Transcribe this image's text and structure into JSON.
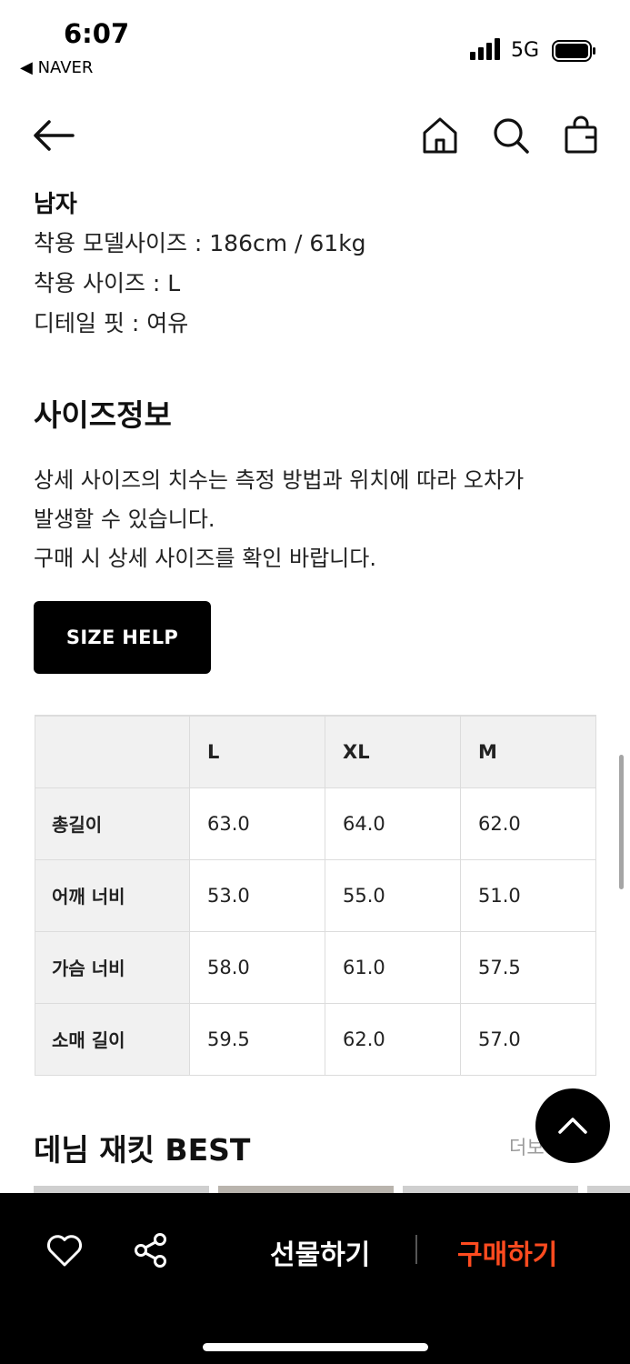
{
  "status_bar": {
    "time": "6:07",
    "back_app": "◀ NAVER",
    "network": "5G"
  },
  "header": {
    "icons": [
      "arrow-left-icon",
      "home-icon",
      "search-icon",
      "shopping-bag-icon"
    ]
  },
  "model_info": {
    "gender": "남자",
    "lines": [
      "착용 모델사이즈 : 186cm / 61kg",
      "착용 사이즈 : L",
      "디테일 핏 : 여유"
    ]
  },
  "size_info": {
    "title": "사이즈정보",
    "description": [
      "상세 사이즈의 치수는 측정 방법과 위치에 따라 오차가",
      "발생할 수 있습니다.",
      "구매 시 상세 사이즈를 확인 바랍니다."
    ],
    "help_button": "SIZE HELP"
  },
  "size_table": {
    "headers": [
      "",
      "L",
      "XL",
      "M"
    ],
    "rows": [
      {
        "label": "총길이",
        "values": [
          "63.0",
          "64.0",
          "62.0"
        ]
      },
      {
        "label": "어깨 너비",
        "values": [
          "53.0",
          "55.0",
          "51.0"
        ]
      },
      {
        "label": "가슴 너비",
        "values": [
          "58.0",
          "61.0",
          "57.5"
        ]
      },
      {
        "label": "소매 길이",
        "values": [
          "59.5",
          "62.0",
          "57.0"
        ]
      }
    ]
  },
  "best_section": {
    "title": "데님 재킷 BEST",
    "more": "더보"
  },
  "bottom_bar": {
    "gift": "선물하기",
    "buy": "구매하기",
    "accent_color": "#ff4b1f"
  }
}
